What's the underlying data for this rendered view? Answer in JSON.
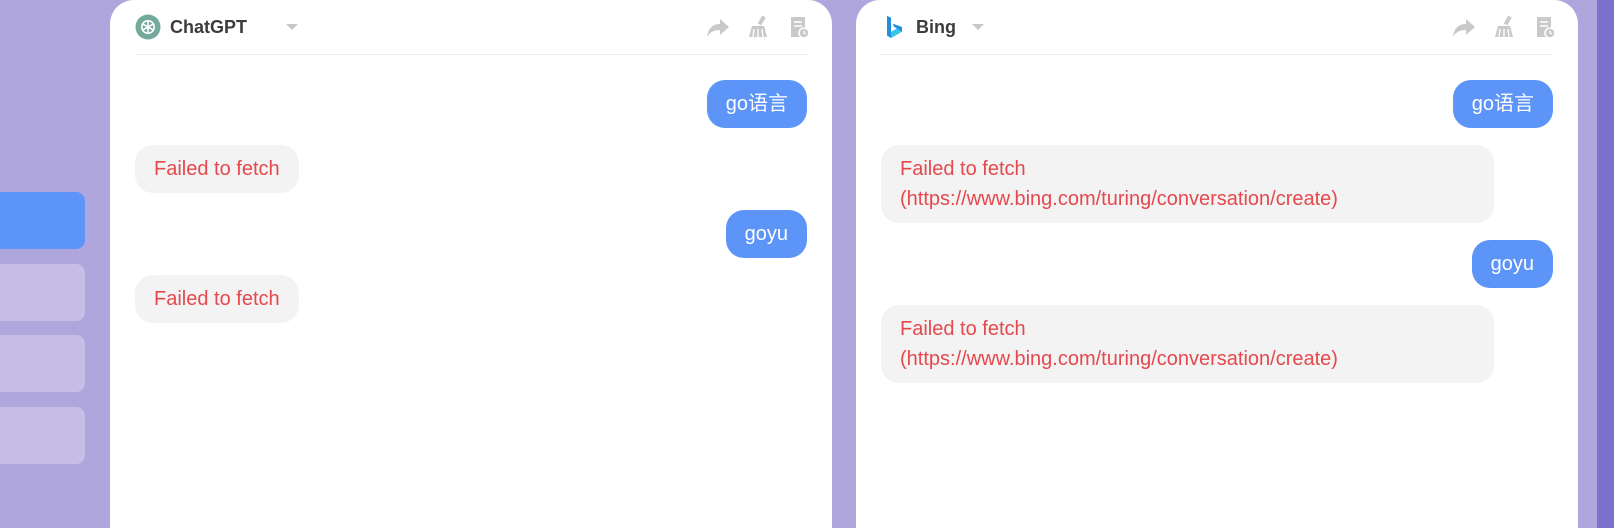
{
  "sidebar": {
    "items": [
      {
        "active": true
      },
      {
        "active": false
      },
      {
        "active": false
      },
      {
        "active": false
      }
    ]
  },
  "panels": [
    {
      "bot": {
        "name": "ChatGPT",
        "icon": "openai-logo-icon"
      },
      "tools": [
        "share-icon",
        "clear-chat-broom-icon",
        "history-icon"
      ],
      "messages": [
        {
          "role": "user",
          "text": "go语言"
        },
        {
          "role": "bot",
          "text": "Failed to fetch"
        },
        {
          "role": "user",
          "text": "goyu"
        },
        {
          "role": "bot",
          "text": "Failed to fetch"
        }
      ]
    },
    {
      "bot": {
        "name": "Bing",
        "icon": "bing-logo-icon"
      },
      "tools": [
        "share-icon",
        "clear-chat-broom-icon",
        "history-icon"
      ],
      "messages": [
        {
          "role": "user",
          "text": "go语言"
        },
        {
          "role": "bot",
          "text": "Failed to fetch",
          "detail": "(https://www.bing.com/turing/conversation/create)"
        },
        {
          "role": "user",
          "text": "goyu"
        },
        {
          "role": "bot",
          "text": "Failed to fetch",
          "detail": "(https://www.bing.com/turing/conversation/create)"
        }
      ]
    }
  ],
  "colors": {
    "background": "#b0a6de",
    "accent": "#5c94f7",
    "error_text": "#e5484d",
    "bot_bubble": "#f3f3f3"
  }
}
